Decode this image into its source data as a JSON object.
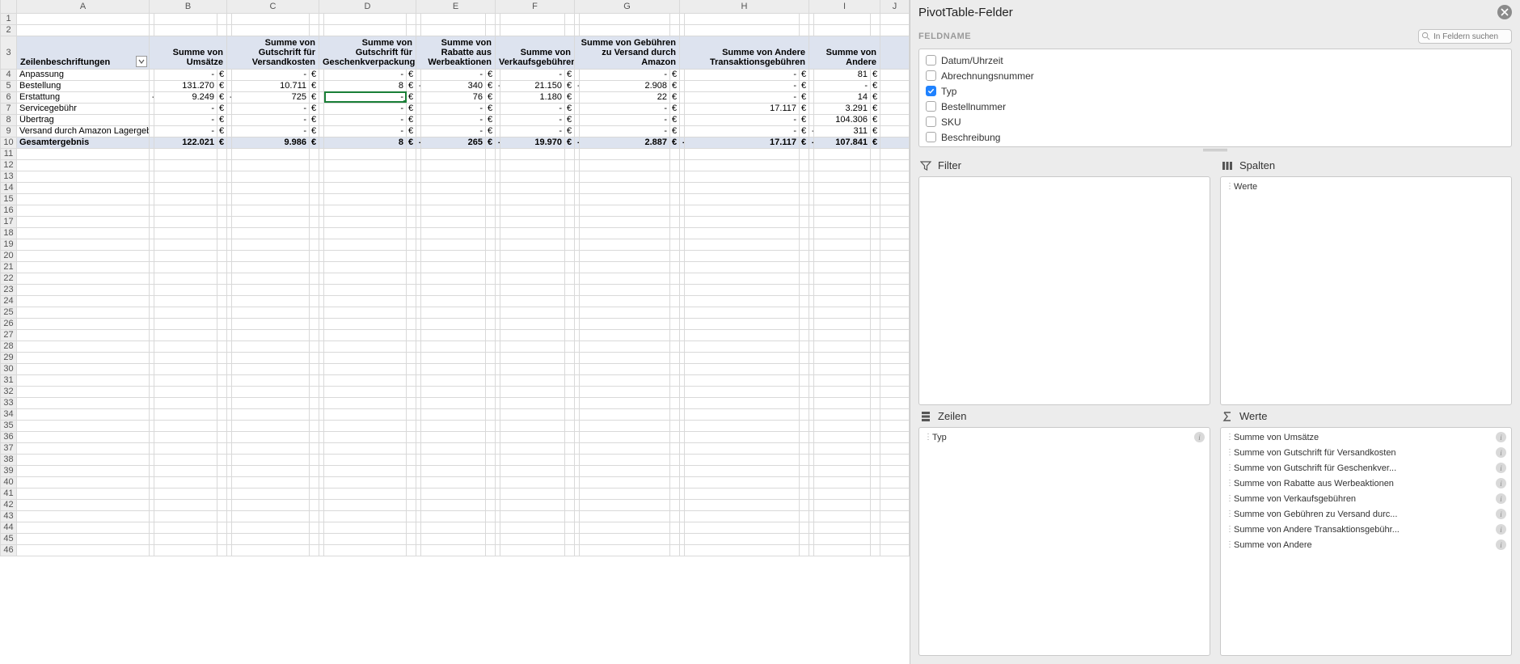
{
  "sheet": {
    "columns": [
      "A",
      "B",
      "C",
      "D",
      "E",
      "F",
      "G",
      "H",
      "I",
      "J"
    ],
    "active_col": "D",
    "active_cell": "D6",
    "pivot": {
      "row_label_header": "Zeilenbeschriftungen",
      "value_headers": [
        "Summe von Umsätze",
        "Summe von Gutschrift für Versandkosten",
        "Summe von Gutschrift für Geschenkverpackung",
        "Summe von Rabatte aus Werbeaktionen",
        "Summe von Verkaufsgebühren",
        "Summe von Gebühren zu Versand durch Amazon",
        "Summe von Andere Transaktionsgebühren",
        "Summe von Andere"
      ],
      "currency": "€",
      "rows": [
        {
          "label": "Anpassung",
          "values": [
            "-",
            "-",
            "-",
            "-",
            "-",
            "-",
            "-",
            "81"
          ],
          "neg": [
            false,
            false,
            false,
            false,
            false,
            false,
            false,
            false
          ]
        },
        {
          "label": "Bestellung",
          "values": [
            "131.270",
            "10.711",
            "8",
            "340",
            "21.150",
            "2.908",
            "-",
            "-"
          ],
          "neg": [
            false,
            false,
            false,
            true,
            true,
            true,
            false,
            false
          ]
        },
        {
          "label": "Erstattung",
          "values": [
            "9.249",
            "725",
            "-",
            "76",
            "1.180",
            "22",
            "-",
            "14"
          ],
          "neg": [
            true,
            true,
            false,
            false,
            false,
            false,
            false,
            false
          ]
        },
        {
          "label": "Servicegebühr",
          "values": [
            "-",
            "-",
            "-",
            "-",
            "-",
            "-",
            "17.117",
            "3.291"
          ],
          "neg": [
            false,
            false,
            false,
            false,
            false,
            false,
            false,
            false
          ]
        },
        {
          "label": "Übertrag",
          "values": [
            "-",
            "-",
            "-",
            "-",
            "-",
            "-",
            "-",
            "104.306"
          ],
          "neg": [
            false,
            false,
            false,
            false,
            false,
            false,
            false,
            false
          ]
        },
        {
          "label": "Versand durch Amazon Lagergebühr",
          "values": [
            "-",
            "-",
            "-",
            "-",
            "-",
            "-",
            "-",
            "311"
          ],
          "neg": [
            false,
            false,
            false,
            false,
            false,
            false,
            false,
            true
          ]
        }
      ],
      "total_label": "Gesamtergebnis",
      "totals": {
        "values": [
          "122.021",
          "9.986",
          "8",
          "265",
          "19.970",
          "2.887",
          "17.117",
          "107.841"
        ],
        "neg": [
          false,
          false,
          false,
          true,
          true,
          true,
          true,
          true
        ]
      }
    }
  },
  "panel": {
    "title": "PivotTable-Felder",
    "fieldname_label": "FELDNAME",
    "search_placeholder": "In Feldern suchen",
    "fields": [
      {
        "label": "Datum/Uhrzeit",
        "checked": false
      },
      {
        "label": "Abrechnungsnummer",
        "checked": false
      },
      {
        "label": "Typ",
        "checked": true
      },
      {
        "label": "Bestellnummer",
        "checked": false
      },
      {
        "label": "SKU",
        "checked": false
      },
      {
        "label": "Beschreibung",
        "checked": false
      }
    ],
    "areas": {
      "filter_label": "Filter",
      "columns_label": "Spalten",
      "rows_label": "Zeilen",
      "values_label": "Werte",
      "columns_items": [
        "Werte"
      ],
      "rows_items": [
        "Typ"
      ],
      "values_items": [
        "Summe von Umsätze",
        "Summe von Gutschrift für Versandkosten",
        "Summe von Gutschrift für Geschenkver...",
        "Summe von Rabatte aus Werbeaktionen",
        "Summe von Verkaufsgebühren",
        "Summe von Gebühren zu Versand durc...",
        "Summe von Andere Transaktionsgebühr...",
        "Summe von Andere"
      ]
    }
  }
}
